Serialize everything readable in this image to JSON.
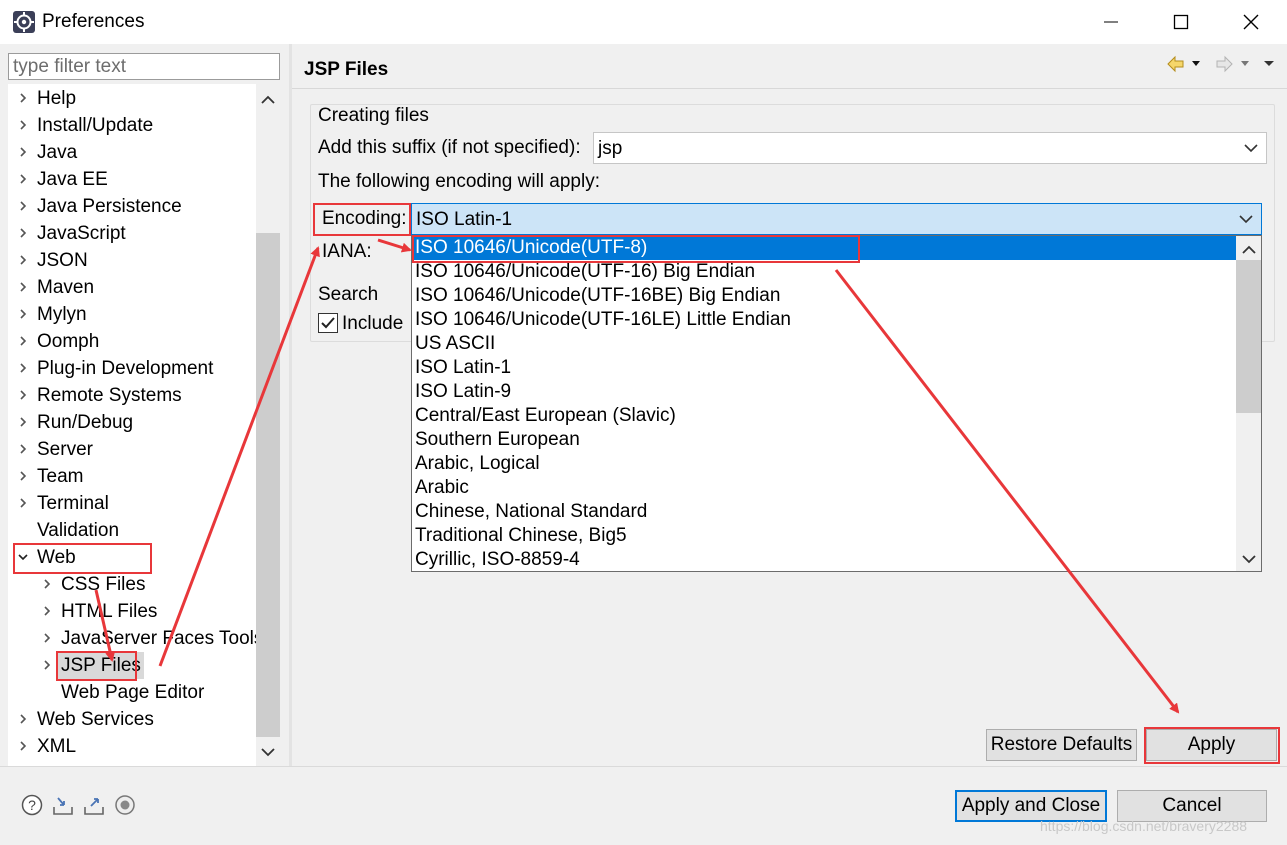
{
  "window": {
    "title": "Preferences",
    "controls": [
      "minimize-icon",
      "maximize-icon",
      "close-icon"
    ]
  },
  "filter": {
    "placeholder": "type filter text",
    "value": ""
  },
  "tree": {
    "items": [
      {
        "label": "Help",
        "level": 0,
        "expandable": true,
        "expanded": false
      },
      {
        "label": "Install/Update",
        "level": 0,
        "expandable": true,
        "expanded": false
      },
      {
        "label": "Java",
        "level": 0,
        "expandable": true,
        "expanded": false
      },
      {
        "label": "Java EE",
        "level": 0,
        "expandable": true,
        "expanded": false
      },
      {
        "label": "Java Persistence",
        "level": 0,
        "expandable": true,
        "expanded": false
      },
      {
        "label": "JavaScript",
        "level": 0,
        "expandable": true,
        "expanded": false
      },
      {
        "label": "JSON",
        "level": 0,
        "expandable": true,
        "expanded": false
      },
      {
        "label": "Maven",
        "level": 0,
        "expandable": true,
        "expanded": false
      },
      {
        "label": "Mylyn",
        "level": 0,
        "expandable": true,
        "expanded": false
      },
      {
        "label": "Oomph",
        "level": 0,
        "expandable": true,
        "expanded": false
      },
      {
        "label": "Plug-in Development",
        "level": 0,
        "expandable": true,
        "expanded": false
      },
      {
        "label": "Remote Systems",
        "level": 0,
        "expandable": true,
        "expanded": false
      },
      {
        "label": "Run/Debug",
        "level": 0,
        "expandable": true,
        "expanded": false
      },
      {
        "label": "Server",
        "level": 0,
        "expandable": true,
        "expanded": false
      },
      {
        "label": "Team",
        "level": 0,
        "expandable": true,
        "expanded": false
      },
      {
        "label": "Terminal",
        "level": 0,
        "expandable": true,
        "expanded": false
      },
      {
        "label": "Validation",
        "level": 0,
        "expandable": false,
        "expanded": false
      },
      {
        "label": "Web",
        "level": 0,
        "expandable": true,
        "expanded": true
      },
      {
        "label": "CSS Files",
        "level": 1,
        "expandable": true,
        "expanded": false
      },
      {
        "label": "HTML Files",
        "level": 1,
        "expandable": true,
        "expanded": false
      },
      {
        "label": "JavaServer Faces Tools",
        "level": 1,
        "expandable": true,
        "expanded": false
      },
      {
        "label": "JSP Files",
        "level": 1,
        "expandable": true,
        "expanded": false,
        "selected": true
      },
      {
        "label": "Web Page Editor",
        "level": 1,
        "expandable": false,
        "expanded": false
      },
      {
        "label": "Web Services",
        "level": 0,
        "expandable": true,
        "expanded": false
      },
      {
        "label": "XML",
        "level": 0,
        "expandable": true,
        "expanded": false
      }
    ]
  },
  "page": {
    "title": "JSP Files",
    "nav_icons": [
      "back-arrow-icon",
      "dropdown-icon",
      "forward-arrow-icon",
      "dropdown-icon",
      "view-menu-icon"
    ],
    "creating_files": {
      "group_label": "Creating files",
      "suffix_label": "Add this suffix (if not specified):",
      "suffix_value": "jsp",
      "encoding_note": "The following encoding will apply:",
      "encoding_label": "Encoding:",
      "encoding_value": "ISO Latin-1",
      "iana_label": "IANA:"
    },
    "search": {
      "group_label": "Search",
      "include_label": "Include",
      "include_checked": true
    },
    "encoding_options": [
      "ISO 10646/Unicode(UTF-8)",
      "ISO 10646/Unicode(UTF-16) Big Endian",
      "ISO 10646/Unicode(UTF-16BE) Big Endian",
      "ISO 10646/Unicode(UTF-16LE) Little Endian",
      "US ASCII",
      "ISO Latin-1",
      "ISO Latin-9",
      "Central/East European (Slavic)",
      "Southern European",
      "Arabic, Logical",
      "Arabic",
      "Chinese, National Standard",
      "Traditional Chinese, Big5",
      "Cyrillic, ISO-8859-4"
    ],
    "highlighted_option": "ISO 10646/Unicode(UTF-8)",
    "restore_defaults_label": "Restore Defaults",
    "apply_label": "Apply"
  },
  "footer": {
    "icons": [
      "help-icon",
      "import-icon",
      "export-icon",
      "record-icon"
    ],
    "apply_close_label": "Apply and Close",
    "cancel_label": "Cancel",
    "watermark": "https://blog.csdn.net/bravery2288"
  },
  "colors": {
    "accent": "#0078d7",
    "annotation": "#e8373a",
    "combo_focus": "#cce4f7"
  }
}
